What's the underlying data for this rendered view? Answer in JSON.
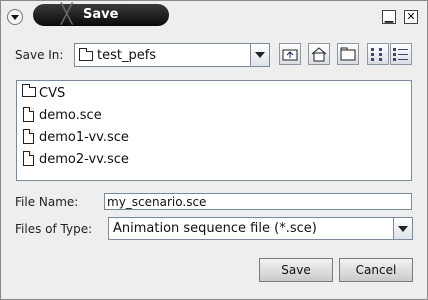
{
  "window": {
    "title": "Save",
    "title_glyph": "╳",
    "iconify_glyph": "▁",
    "close_glyph": "✕"
  },
  "save_in": {
    "label": "Save In:",
    "current_folder": "test_pefs"
  },
  "toolbar": {
    "up_icon": "up-folder-icon",
    "home_icon": "home-icon",
    "new_folder_icon": "new-folder-icon",
    "list_view_icon": "list-view-icon",
    "details_view_icon": "details-view-icon"
  },
  "files": [
    {
      "name": "CVS",
      "type": "folder"
    },
    {
      "name": "demo.sce",
      "type": "file"
    },
    {
      "name": "demo1-vv.sce",
      "type": "file"
    },
    {
      "name": "demo2-vv.sce",
      "type": "file"
    }
  ],
  "file_name": {
    "label": "File Name:",
    "value": "my_scenario.sce"
  },
  "files_of_type": {
    "label": "Files of Type:",
    "value": "Animation sequence file (*.sce)"
  },
  "buttons": {
    "save": "Save",
    "cancel": "Cancel"
  }
}
